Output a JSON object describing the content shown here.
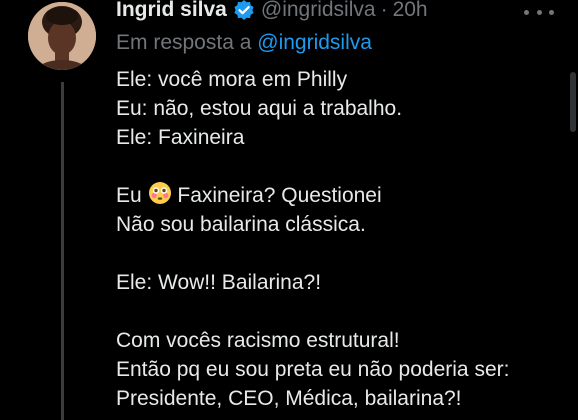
{
  "tweet": {
    "author_name": "Ingrid silva",
    "handle": "@ingridsilva",
    "separator": "·",
    "time": "20h",
    "reply_prefix": "Em resposta a",
    "reply_handle": "@ingridsilva",
    "lines": {
      "l1": "Ele: você mora em Philly",
      "l2": "Eu: não, estou aqui a trabalho.",
      "l3": "Ele: Faxineira",
      "l4_prefix": "Eu",
      "l4_rest": "Faxineira? Questionei",
      "l5": "Não sou bailarina clássica.",
      "l6": "Ele: Wow!! Bailarina?!",
      "l7": "Com vocês racismo estrutural!",
      "l8": "Então pq eu sou preta eu não poderia ser:",
      "l9": "Presidente, CEO, Médica, bailarina?!"
    },
    "emoji": "flushed-face-emoji"
  },
  "icons": {
    "verified": "verified-badge-icon",
    "more": "more-options-icon"
  },
  "colors": {
    "background": "#000000",
    "text": "#e7e9ea",
    "muted": "#71767b",
    "accent": "#1d9bf0"
  }
}
